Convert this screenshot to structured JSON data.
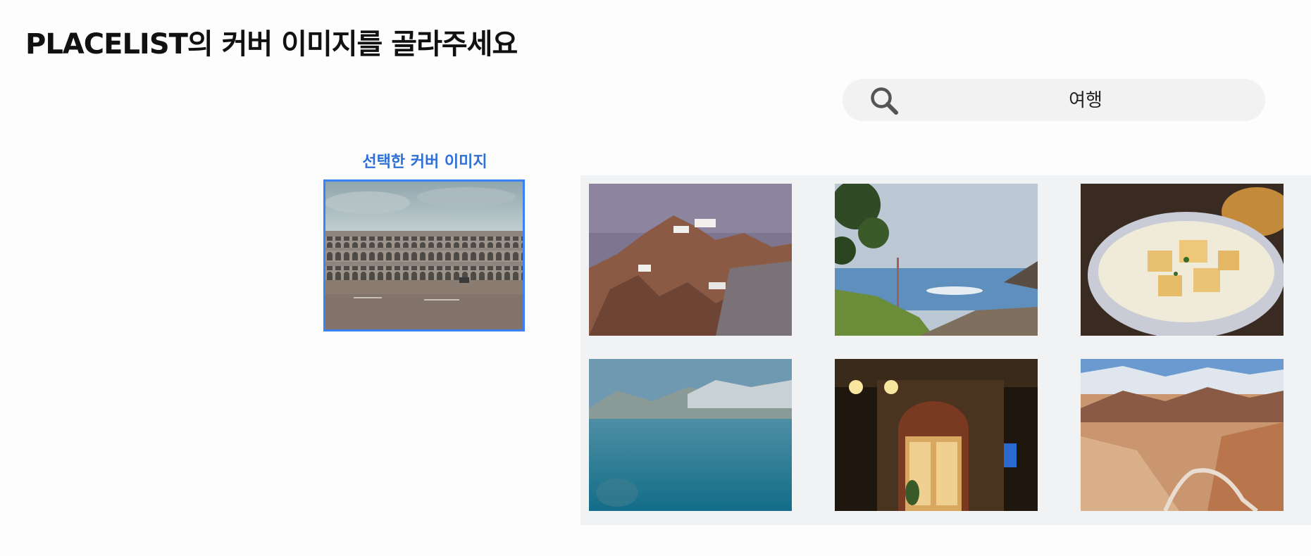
{
  "header": {
    "title": "PLACELIST의 커버 이미지를 골라주세요"
  },
  "search": {
    "icon": "search-icon",
    "query": "여행"
  },
  "selected": {
    "label": "선택한 커버 이미지",
    "image": "venice-piazza-arcade-photo",
    "border_color": "#3b82f6"
  },
  "gallery": {
    "images": [
      "mountain-monastery-cliff-photo",
      "tree-and-sky-pagoda-roof-photo",
      "croutons-cream-soup-photo",
      "blue-mountain-lake-photo",
      "night-cafe-entrance-photo",
      "desert-mountain-road-photo"
    ]
  },
  "colors": {
    "accent": "#2f6fd6",
    "gallery_bg": "#f1f2f4",
    "search_bg": "#f2f2f2"
  }
}
